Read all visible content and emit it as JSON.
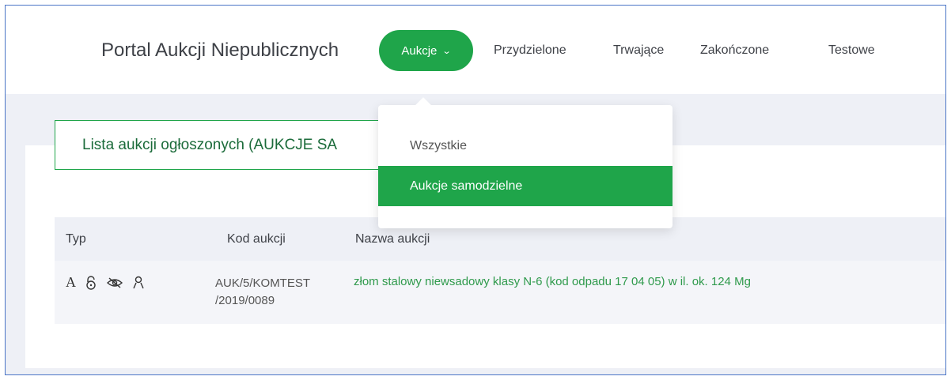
{
  "header": {
    "brand": "Portal Aukcji Niepublicznych",
    "nav": {
      "active": "Aukcje",
      "items": [
        "Przydzielone",
        "Trwające",
        "Zakończone",
        "Testowe"
      ]
    }
  },
  "dropdown": {
    "items": [
      "Wszystkie",
      "Aukcje samodzielne"
    ],
    "selected": "Aukcje samodzielne"
  },
  "list": {
    "title": "Lista aukcji ogłoszonych (AUKCJE SA",
    "columns": [
      "Typ",
      "Kod aukcji",
      "Nazwa aukcji"
    ],
    "rows": [
      {
        "type_letter": "A",
        "type_icons": [
          "lock-icon",
          "eye-off-icon",
          "user-icon"
        ],
        "code_line1": "AUK/5/KOMTEST",
        "code_line2": "/2019/0089",
        "name": "złom stalowy niewsadowy klasy N-6 (kod odpadu 17 04 05) w il. ok. 124 Mg"
      }
    ]
  },
  "colors": {
    "accent": "#1fa54a",
    "link": "#2f9a4c",
    "frame_border": "#4a74c6"
  }
}
